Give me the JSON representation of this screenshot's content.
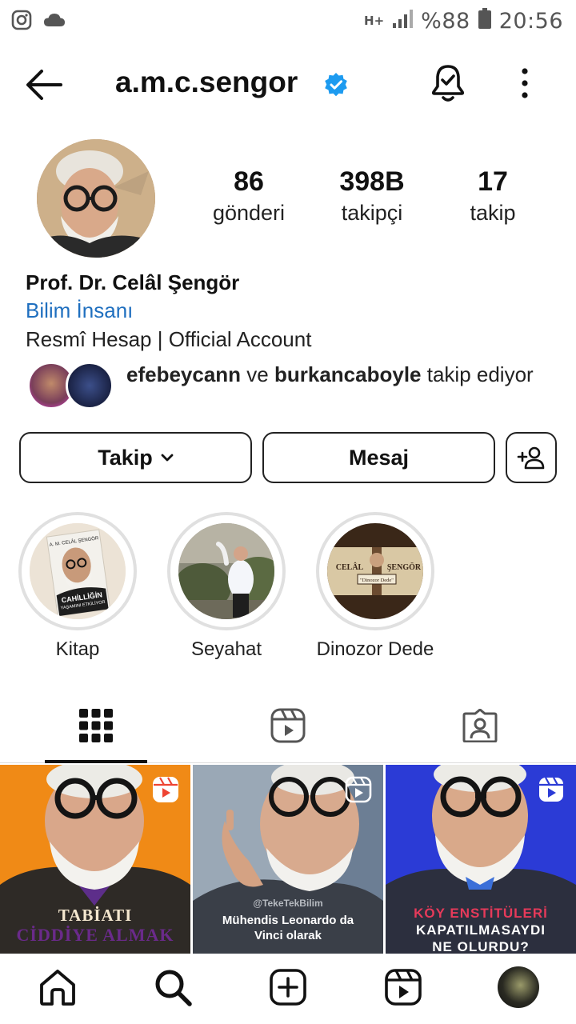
{
  "status_bar": {
    "battery": "%88",
    "time": "20:56",
    "network": "H+"
  },
  "header": {
    "username": "a.m.c.sengor"
  },
  "profile": {
    "stats": [
      {
        "value": "86",
        "label": "gönderi"
      },
      {
        "value": "398B",
        "label": "takipçi"
      },
      {
        "value": "17",
        "label": "takip"
      }
    ],
    "full_name": "Prof. Dr. Celâl Şengör",
    "category": "Bilim İnsanı",
    "bio": "Resmî Hesap | Official Account",
    "followed_by": {
      "user1": "efebeycann",
      "joiner": " ve ",
      "user2": "burkancaboyle",
      "suffix": " takip ediyor"
    }
  },
  "actions": {
    "follow_label": "Takip",
    "message_label": "Mesaj"
  },
  "highlights": [
    {
      "label": "Kitap"
    },
    {
      "label": "Seyahat"
    },
    {
      "label": "Dinozor Dede"
    }
  ],
  "highlight_texts": {
    "book_author": "A. M. CELÂL ŞENGÖR",
    "book_title_1": "CAHİLLİĞİN",
    "book_title_2": "YAŞAMINI ETKİLİYOR",
    "dede_left": "CELÂL",
    "dede_right": "ŞENGÖR",
    "dede_sub": "\"Dinozor Dede\""
  },
  "posts": [
    {
      "caption_line1": "TABİATI",
      "caption_line2": "CİDDİYE ALMAK"
    },
    {
      "caption_line1": "Mühendis Leonardo da",
      "caption_line2": "Vinci olarak",
      "watermark": "@TekeTekBilim"
    },
    {
      "caption_line1": "KÖY ENSTİTÜLERİ",
      "caption_line2": "KAPATILMASAYDI",
      "caption_line3": "NE OLURDU?"
    }
  ],
  "colors": {
    "verified": "#1d9bf0",
    "link": "#1f6fbf",
    "post1_bg": "#f08a16",
    "post3_bg": "#2b3bd6"
  }
}
